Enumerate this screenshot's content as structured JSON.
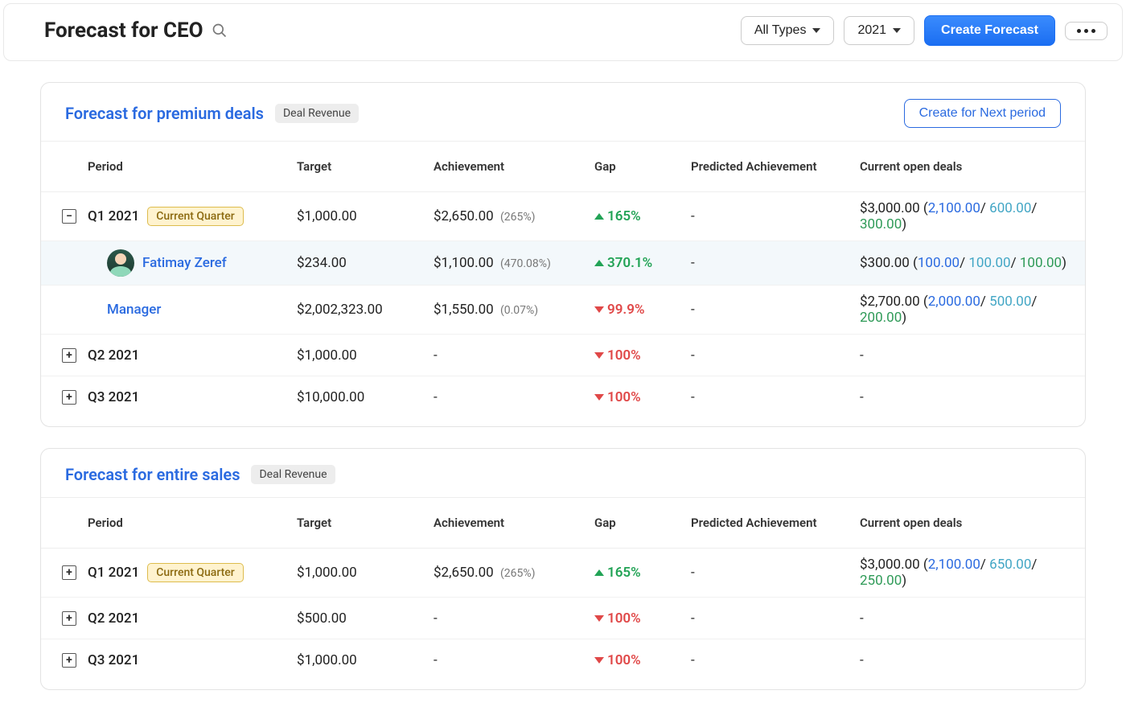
{
  "topbar": {
    "title": "Forecast for CEO",
    "type_filter": "All Types",
    "year_filter": "2021",
    "create_label": "Create Forecast"
  },
  "columns": {
    "period": "Period",
    "target": "Target",
    "achievement": "Achievement",
    "gap": "Gap",
    "predicted": "Predicted Achievement",
    "open": "Current open deals"
  },
  "sections": [
    {
      "title": "Forecast for premium deals",
      "tag": "Deal Revenue",
      "action": "Create for Next period",
      "rows": [
        {
          "expander": "minus",
          "period": "Q1 2021",
          "badge": "Current Quarter",
          "target": "$1,000.00",
          "achievement": "$2,650.00",
          "ach_pct": "(265%)",
          "gap_dir": "up",
          "gap": "165%",
          "predicted": "-",
          "open_total": "$3,000.00",
          "open_b1": "2,100.00",
          "open_b2": "600.00",
          "open_b3": "300.00"
        },
        {
          "style": "sub",
          "avatar": true,
          "name": "Fatimay Zeref",
          "target": "$234.00",
          "achievement": "$1,100.00",
          "ach_pct": "(470.08%)",
          "gap_dir": "up",
          "gap": "370.1%",
          "predicted": "-",
          "open_total": "$300.00",
          "open_b1": "100.00",
          "open_b2": "100.00",
          "open_b3": "100.00"
        },
        {
          "style": "sub-plain",
          "name": "Manager",
          "target": "$2,002,323.00",
          "achievement": "$1,550.00",
          "ach_pct": "(0.07%)",
          "gap_dir": "down",
          "gap": "99.9%",
          "predicted": "-",
          "open_total": "$2,700.00",
          "open_b1": "2,000.00",
          "open_b2": "500.00",
          "open_b3": "200.00"
        },
        {
          "expander": "plus",
          "period": "Q2 2021",
          "target": "$1,000.00",
          "achievement": "-",
          "gap_dir": "down",
          "gap": "100%",
          "predicted": "-",
          "open_total": "-"
        },
        {
          "expander": "plus",
          "period": "Q3 2021",
          "target": "$10,000.00",
          "achievement": "-",
          "gap_dir": "down",
          "gap": "100%",
          "predicted": "-",
          "open_total": "-"
        }
      ]
    },
    {
      "title": "Forecast for entire sales",
      "tag": "Deal Revenue",
      "rows": [
        {
          "expander": "plus",
          "period": "Q1 2021",
          "badge": "Current Quarter",
          "target": "$1,000.00",
          "achievement": "$2,650.00",
          "ach_pct": "(265%)",
          "gap_dir": "up",
          "gap": "165%",
          "predicted": "-",
          "open_total": "$3,000.00",
          "open_b1": "2,100.00",
          "open_b2": "650.00",
          "open_b3": "250.00"
        },
        {
          "expander": "plus",
          "period": "Q2 2021",
          "target": "$500.00",
          "achievement": "-",
          "gap_dir": "down",
          "gap": "100%",
          "predicted": "-",
          "open_total": "-"
        },
        {
          "expander": "plus",
          "period": "Q3 2021",
          "target": "$1,000.00",
          "achievement": "-",
          "gap_dir": "down",
          "gap": "100%",
          "predicted": "-",
          "open_total": "-"
        }
      ]
    }
  ]
}
